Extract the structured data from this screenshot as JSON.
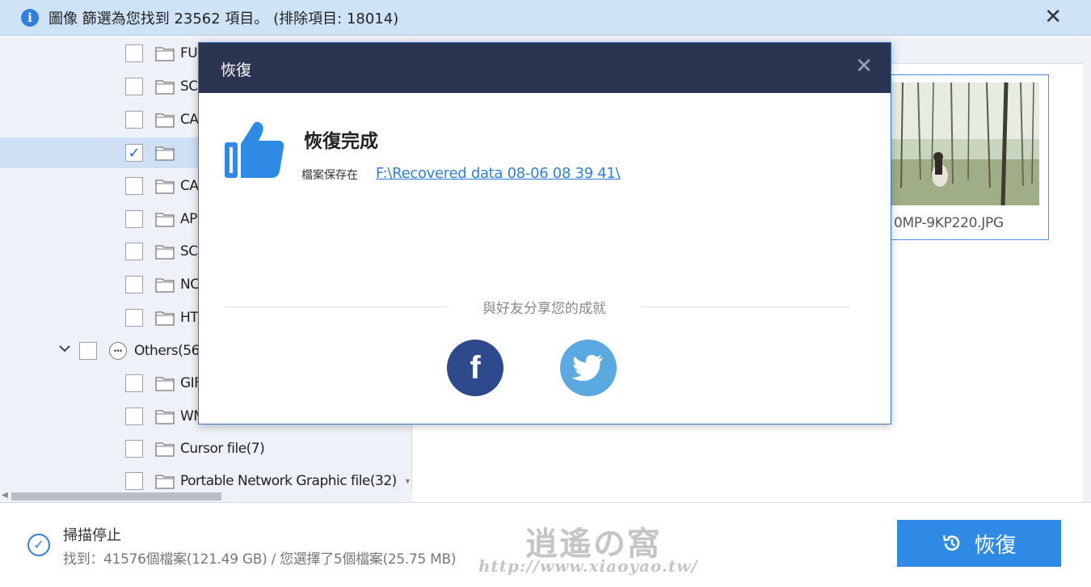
{
  "banner": {
    "icon": "info-icon",
    "message": "圖像 篩選為您找到 23562 項目。 (排除項目: 18014)",
    "close_glyph": "✕"
  },
  "tree": {
    "items": [
      {
        "label": "FU",
        "checked": false,
        "icon": "folder-icon"
      },
      {
        "label": "SC",
        "checked": false,
        "icon": "folder-icon"
      },
      {
        "label": "CA",
        "checked": false,
        "icon": "folder-icon"
      },
      {
        "label": "",
        "checked": true,
        "icon": "folder-icon"
      },
      {
        "label": "CA",
        "checked": false,
        "icon": "folder-icon"
      },
      {
        "label": "AP",
        "checked": false,
        "icon": "folder-icon"
      },
      {
        "label": "SC",
        "checked": false,
        "icon": "folder-icon"
      },
      {
        "label": "NC",
        "checked": false,
        "icon": "folder-icon"
      },
      {
        "label": "HT",
        "checked": false,
        "icon": "folder-icon"
      }
    ],
    "others": {
      "label": "Others(56",
      "icon": "more-icon",
      "expanded": true
    },
    "others_items": [
      {
        "label": "GIF",
        "checked": false,
        "icon": "folder-icon"
      },
      {
        "label": "WM",
        "checked": false,
        "icon": "folder-icon"
      },
      {
        "label": "Cursor file(7)",
        "checked": false,
        "icon": "folder-icon"
      },
      {
        "label": "Portable Network Graphic file(32)",
        "checked": false,
        "icon": "folder-icon"
      }
    ]
  },
  "content": {
    "thumbnail_name": "0MP-9KP220.JPG"
  },
  "status": {
    "title": "掃描停止",
    "detail": "找到：41576個檔案(121.49 GB) / 您選擇了5個檔案(25.75 MB)"
  },
  "recover_button": {
    "label": "恢復",
    "icon": "restore-icon"
  },
  "watermark": {
    "title": "逍遙の窩",
    "url": "http://www.xiaoyao.tw/"
  },
  "modal": {
    "title": "恢復",
    "close_glyph": "✕",
    "heading": "恢復完成",
    "save_label": "檔案保存在",
    "save_path": "F:\\Recovered data 08-06 08 39 41\\",
    "share_text": "與好友分享您的成就",
    "facebook_glyph": "f",
    "icons": [
      "thumbs-up-icon",
      "facebook-icon",
      "twitter-icon"
    ]
  },
  "colors": {
    "accent": "#2f8ae6",
    "modal_header": "#2b3450",
    "facebook": "#2e4a8c",
    "twitter": "#5aa9e0",
    "banner_bg": "#cfe3f7"
  }
}
